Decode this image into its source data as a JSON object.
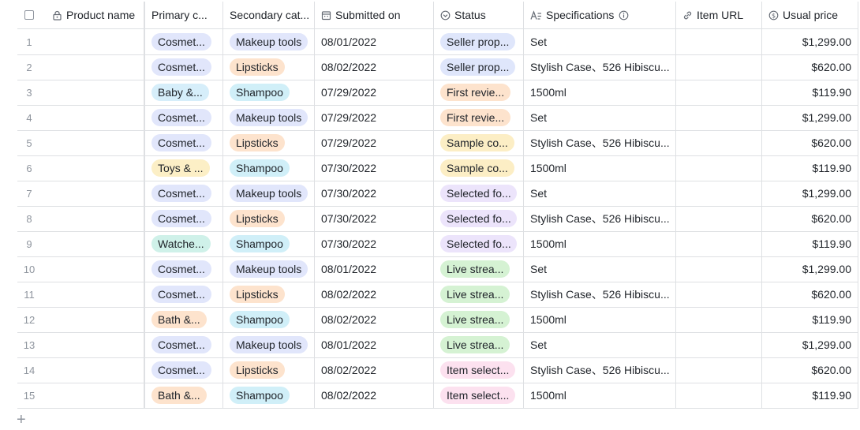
{
  "columns": {
    "product_name": "Product name",
    "primary_category": "Primary c...",
    "secondary_category": "Secondary cat...",
    "submitted_on": "Submitted on",
    "status": "Status",
    "specifications": "Specifications",
    "item_url": "Item URL",
    "usual_price": "Usual price"
  },
  "colors": {
    "cosmetics": "#e1e6fb",
    "baby": "#d6eefa",
    "toys": "#fcefc6",
    "watches": "#cff1e9",
    "bath": "#fde3cd",
    "makeup": "#e1e6fb",
    "lipsticks": "#fde3cd",
    "shampoo": "#d0eff8",
    "seller": "#dfe6fb",
    "first": "#fde3cd",
    "sample": "#fceec5",
    "selected": "#ece4fb",
    "live": "#d5f2d3",
    "item": "#fce1ef"
  },
  "rows": [
    {
      "n": "1",
      "pri": "Cosmet...",
      "pc": "cosmetics",
      "sec": "Makeup tools",
      "sc": "makeup",
      "date": "08/01/2022",
      "stat": "Seller prop...",
      "stc": "seller",
      "spec": "Set",
      "price": "$1,299.00"
    },
    {
      "n": "2",
      "pri": "Cosmet...",
      "pc": "cosmetics",
      "sec": "Lipsticks",
      "sc": "lipsticks",
      "date": "08/02/2022",
      "stat": "Seller prop...",
      "stc": "seller",
      "spec": "Stylish Case、526 Hibiscu...",
      "price": "$620.00"
    },
    {
      "n": "3",
      "pri": "Baby &...",
      "pc": "baby",
      "sec": "Shampoo",
      "sc": "shampoo",
      "date": "07/29/2022",
      "stat": "First revie...",
      "stc": "first",
      "spec": "1500ml",
      "price": "$119.90"
    },
    {
      "n": "4",
      "pri": "Cosmet...",
      "pc": "cosmetics",
      "sec": "Makeup tools",
      "sc": "makeup",
      "date": "07/29/2022",
      "stat": "First revie...",
      "stc": "first",
      "spec": "Set",
      "price": "$1,299.00"
    },
    {
      "n": "5",
      "pri": "Cosmet...",
      "pc": "cosmetics",
      "sec": "Lipsticks",
      "sc": "lipsticks",
      "date": "07/29/2022",
      "stat": "Sample co...",
      "stc": "sample",
      "spec": "Stylish Case、526 Hibiscu...",
      "price": "$620.00"
    },
    {
      "n": "6",
      "pri": "Toys & ...",
      "pc": "toys",
      "sec": "Shampoo",
      "sc": "shampoo",
      "date": "07/30/2022",
      "stat": "Sample co...",
      "stc": "sample",
      "spec": "1500ml",
      "price": "$119.90"
    },
    {
      "n": "7",
      "pri": "Cosmet...",
      "pc": "cosmetics",
      "sec": "Makeup tools",
      "sc": "makeup",
      "date": "07/30/2022",
      "stat": "Selected fo...",
      "stc": "selected",
      "spec": "Set",
      "price": "$1,299.00"
    },
    {
      "n": "8",
      "pri": "Cosmet...",
      "pc": "cosmetics",
      "sec": "Lipsticks",
      "sc": "lipsticks",
      "date": "07/30/2022",
      "stat": "Selected fo...",
      "stc": "selected",
      "spec": "Stylish Case、526 Hibiscu...",
      "price": "$620.00"
    },
    {
      "n": "9",
      "pri": "Watche...",
      "pc": "watches",
      "sec": "Shampoo",
      "sc": "shampoo",
      "date": "07/30/2022",
      "stat": "Selected fo...",
      "stc": "selected",
      "spec": "1500ml",
      "price": "$119.90"
    },
    {
      "n": "10",
      "pri": "Cosmet...",
      "pc": "cosmetics",
      "sec": "Makeup tools",
      "sc": "makeup",
      "date": "08/01/2022",
      "stat": "Live strea...",
      "stc": "live",
      "spec": "Set",
      "price": "$1,299.00"
    },
    {
      "n": "11",
      "pri": "Cosmet...",
      "pc": "cosmetics",
      "sec": "Lipsticks",
      "sc": "lipsticks",
      "date": "08/02/2022",
      "stat": "Live strea...",
      "stc": "live",
      "spec": "Stylish Case、526 Hibiscu...",
      "price": "$620.00"
    },
    {
      "n": "12",
      "pri": "Bath &...",
      "pc": "bath",
      "sec": "Shampoo",
      "sc": "shampoo",
      "date": "08/02/2022",
      "stat": "Live strea...",
      "stc": "live",
      "spec": "1500ml",
      "price": "$119.90"
    },
    {
      "n": "13",
      "pri": "Cosmet...",
      "pc": "cosmetics",
      "sec": "Makeup tools",
      "sc": "makeup",
      "date": "08/01/2022",
      "stat": "Live strea...",
      "stc": "live",
      "spec": "Set",
      "price": "$1,299.00"
    },
    {
      "n": "14",
      "pri": "Cosmet...",
      "pc": "cosmetics",
      "sec": "Lipsticks",
      "sc": "lipsticks",
      "date": "08/02/2022",
      "stat": "Item select...",
      "stc": "item",
      "spec": "Stylish Case、526 Hibiscu...",
      "price": "$620.00"
    },
    {
      "n": "15",
      "pri": "Bath &...",
      "pc": "bath",
      "sec": "Shampoo",
      "sc": "shampoo",
      "date": "08/02/2022",
      "stat": "Item select...",
      "stc": "item",
      "spec": "1500ml",
      "price": "$119.90"
    }
  ],
  "add_row_label": "+"
}
